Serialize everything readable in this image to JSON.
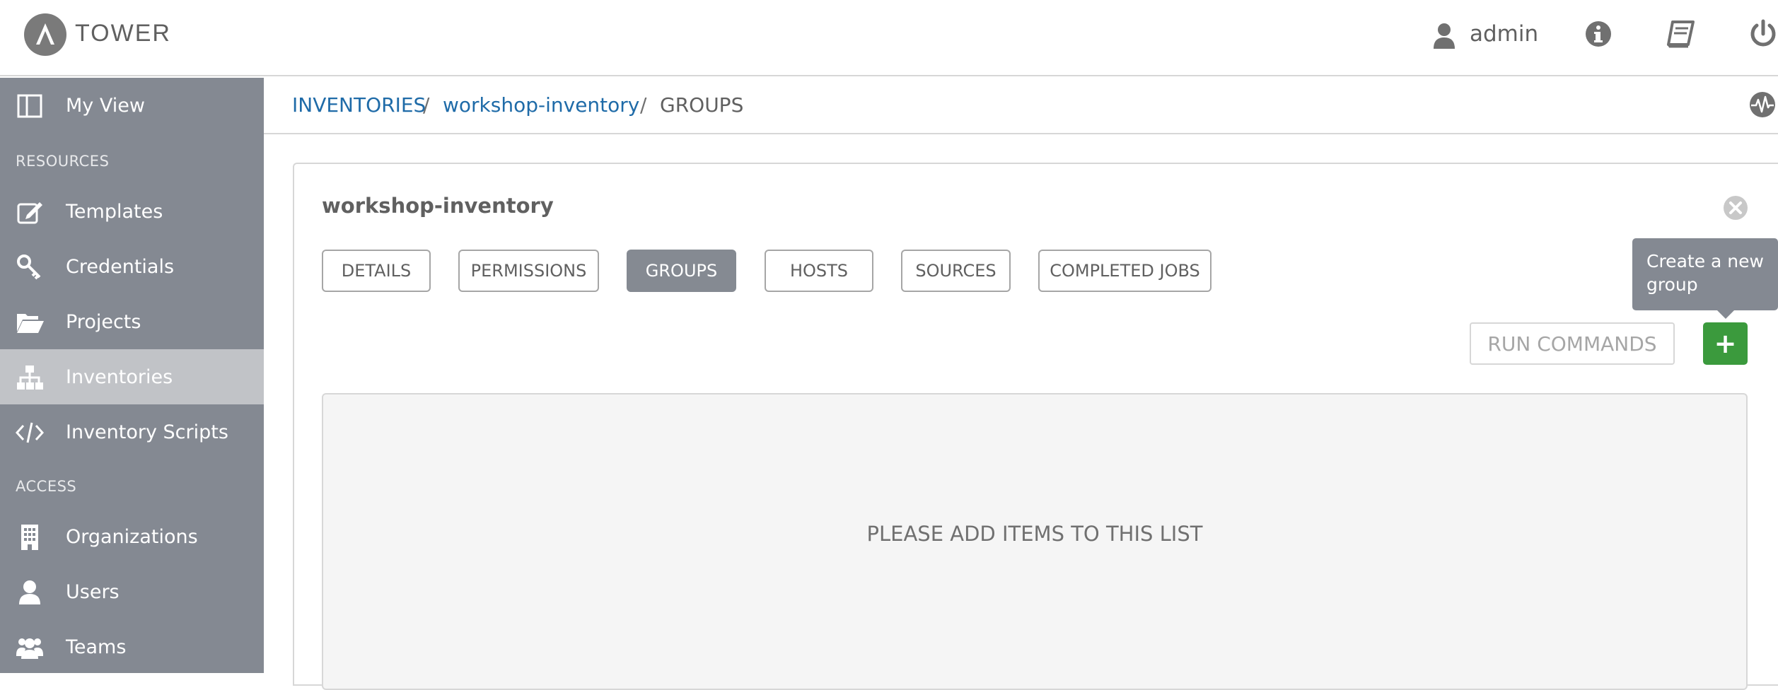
{
  "header": {
    "brand": "TOWER",
    "user": "admin"
  },
  "sidebar": {
    "items": [
      {
        "label": "My View",
        "icon": "columns-icon"
      },
      {
        "section": "RESOURCES"
      },
      {
        "label": "Templates",
        "icon": "edit-icon"
      },
      {
        "label": "Credentials",
        "icon": "key-icon"
      },
      {
        "label": "Projects",
        "icon": "folder-open-icon"
      },
      {
        "label": "Inventories",
        "icon": "sitemap-icon",
        "active": true
      },
      {
        "label": "Inventory Scripts",
        "icon": "code-icon"
      },
      {
        "section": "ACCESS"
      },
      {
        "label": "Organizations",
        "icon": "building-icon"
      },
      {
        "label": "Users",
        "icon": "user-icon"
      },
      {
        "label": "Teams",
        "icon": "users-icon"
      }
    ]
  },
  "breadcrumb": {
    "root": "INVENTORIES",
    "sep1": "/",
    "inventory": "workshop-inventory",
    "sep2": "/",
    "current": "GROUPS"
  },
  "panel": {
    "title": "workshop-inventory",
    "tabs": [
      {
        "label": "DETAILS"
      },
      {
        "label": "PERMISSIONS"
      },
      {
        "label": "GROUPS",
        "active": true
      },
      {
        "label": "HOSTS"
      },
      {
        "label": "SOURCES"
      },
      {
        "label": "COMPLETED JOBS"
      }
    ],
    "tooltip_line1": "Create a new",
    "tooltip_line2": "group",
    "run_commands": "RUN COMMANDS",
    "add_label": "+",
    "empty_message": "PLEASE ADD ITEMS TO THIS LIST"
  },
  "colors": {
    "sidebar_bg": "#848992",
    "sidebar_active": "#c1c3c7",
    "link": "#1f6ba8",
    "add_button": "#3b9a3d"
  }
}
